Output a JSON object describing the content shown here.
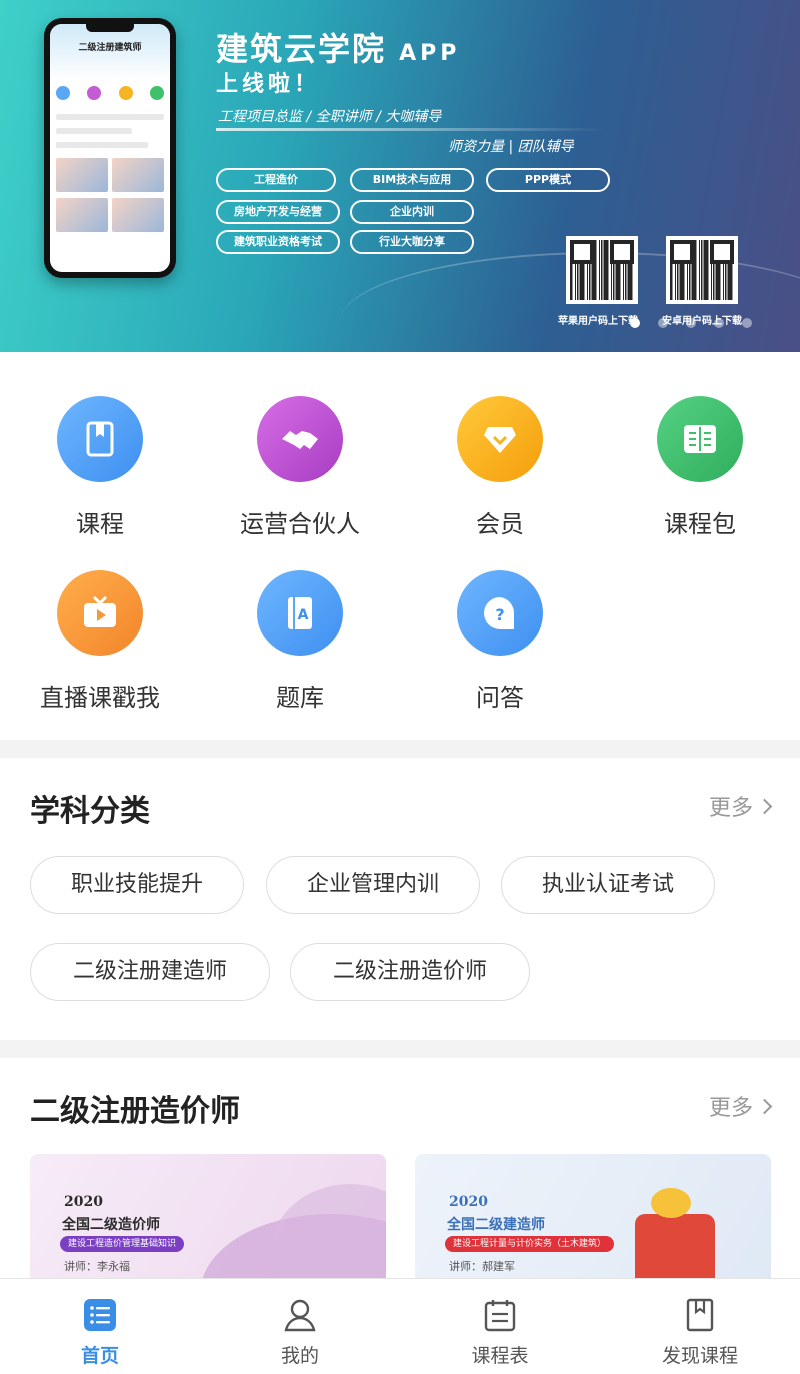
{
  "banner": {
    "title": "建筑云学院",
    "title_suffix": "APP",
    "title_line2": "上线啦！",
    "subtitle1": "工程项目总监 / 全职讲师 / 大咖辅导",
    "subtitle2": "师资力量 | 团队辅导",
    "phone_heading": "二级注册建筑师",
    "tags": [
      "工程造价",
      "BIM技术与应用",
      "PPP模式",
      "房地产开发与经营",
      "企业内训",
      "建筑职业资格考试",
      "行业大咖分享"
    ],
    "qr_ios_label": "苹果用户码上下载",
    "qr_android_label": "安卓用户码上下载",
    "dots_total": 5,
    "dots_active": 0
  },
  "features": [
    {
      "label": "课程",
      "icon": "book-icon",
      "color": "#5aa7f5"
    },
    {
      "label": "运营合伙人",
      "icon": "handshake-icon",
      "color": "#c45bd4"
    },
    {
      "label": "会员",
      "icon": "vip-badge-icon",
      "color": "#f5b423"
    },
    {
      "label": "课程包",
      "icon": "open-book-icon",
      "color": "#3ec16a"
    },
    {
      "label": "直播课戳我",
      "icon": "tv-play-icon",
      "color": "#f59a3a"
    },
    {
      "label": "题库",
      "icon": "question-bank-icon",
      "color": "#5aa7f5"
    },
    {
      "label": "问答",
      "icon": "question-bubble-icon",
      "color": "#5aa7f5"
    }
  ],
  "categories": {
    "title": "学科分类",
    "more": "更多",
    "chips": [
      "职业技能提升",
      "企业管理内训",
      "执业认证考试",
      "二级注册建造师",
      "二级注册造价师"
    ]
  },
  "course_section": {
    "title": "二级注册造价师",
    "more": "更多",
    "cards": [
      {
        "year": "2020",
        "title": "全国二级造价师",
        "pill": "建设工程造价管理基础知识",
        "lecturer": "讲师：李永福",
        "pill_color": "#7b3fc4"
      },
      {
        "year": "2020",
        "title": "全国二级建造师",
        "pill": "建设工程计量与计价实务（土木建筑）",
        "lecturer": "讲师：郝建军",
        "pill_color": "#e0323a"
      }
    ]
  },
  "tabbar": {
    "tabs": [
      {
        "label": "首页",
        "icon": "home-list-icon",
        "active": true
      },
      {
        "label": "我的",
        "icon": "user-icon",
        "active": false
      },
      {
        "label": "课程表",
        "icon": "schedule-icon",
        "active": false
      },
      {
        "label": "发现课程",
        "icon": "discover-book-icon",
        "active": false
      }
    ],
    "active_color": "#3a8ee6"
  }
}
